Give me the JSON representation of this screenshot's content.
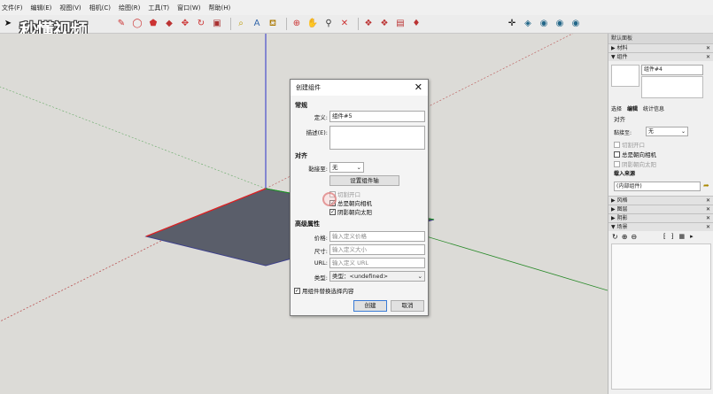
{
  "menu": [
    "文件(F)",
    "编辑(E)",
    "视图(V)",
    "相机(C)",
    "绘图(R)",
    "工具(T)",
    "窗口(W)",
    "帮助(H)"
  ],
  "watermark": "秒懂视频",
  "right_panel": {
    "title": "默认面板",
    "sections": {
      "materials": "材料",
      "components": "组件",
      "styles": "风格",
      "layers": "图层",
      "shadows": "阴影",
      "scenes": "场景"
    },
    "component_name": "组件#4",
    "tabs": {
      "select": "选择",
      "edit": "编辑",
      "stats": "统计信息"
    },
    "align_heading": "对齐",
    "glue_to_label": "黏接至:",
    "glue_to_value": "无",
    "cut_opening": "切割开口",
    "always_face_camera": "总是朝向相机",
    "shadows_face_sun": "阴影朝向太阳",
    "load_from": "载入来源",
    "load_from_value": "(内部组件)"
  },
  "dialog": {
    "title": "创建组件",
    "general_heading": "常规",
    "definition_label": "定义:",
    "definition_value": "组件#5",
    "description_label": "描述(E):",
    "align_heading": "对齐",
    "glue_to_label": "黏接至:",
    "glue_to_value": "无",
    "set_axes_button": "设置组件轴",
    "cut_opening": "切割开口",
    "always_face_camera": "总是朝向相机",
    "shadows_face_sun": "阴影朝向太阳",
    "advanced_heading": "高级属性",
    "price_label": "价格:",
    "price_placeholder": "输入定义价格",
    "size_label": "尺寸:",
    "size_placeholder": "输入定义大小",
    "url_label": "URL:",
    "url_placeholder": "输入定义 URL",
    "type_label": "类型:",
    "type_value": "类型：<undefined>",
    "replace_selection": "用组件替换选择内容",
    "create_button": "创建",
    "cancel_button": "取消"
  }
}
